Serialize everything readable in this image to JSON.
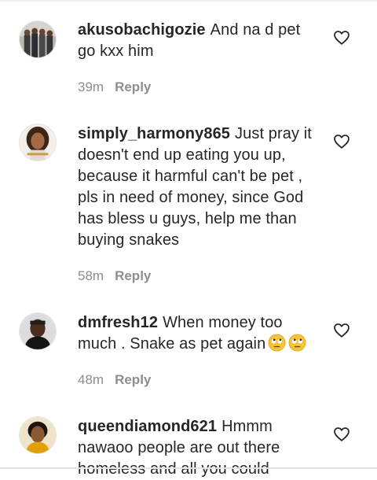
{
  "comments": [
    {
      "username": "akusobachigozie",
      "text": "And na d pet go kxx him",
      "time": "39m",
      "reply_label": "Reply"
    },
    {
      "username": "simply_harmony865",
      "text": "Just pray it doesn't end up eating you up, because it harmful can't be pet , pls in need of money, since God has bless u guys, help me than buying snakes",
      "time": "58m",
      "reply_label": "Reply"
    },
    {
      "username": "dmfresh12",
      "text": "When money too much . Snake as pet again",
      "emojis": [
        "eye-roll-emoji",
        "eye-roll-emoji"
      ],
      "time": "48m",
      "reply_label": "Reply"
    },
    {
      "username": "queendiamond621",
      "text": "Hmmm nawaoo people are out there homeless and all you could",
      "time": "",
      "reply_label": ""
    }
  ],
  "icons": {
    "like": "heart-outline-icon"
  },
  "colors": {
    "text": "#262626",
    "secondary": "#8e8e8e",
    "background": "#ffffff"
  }
}
